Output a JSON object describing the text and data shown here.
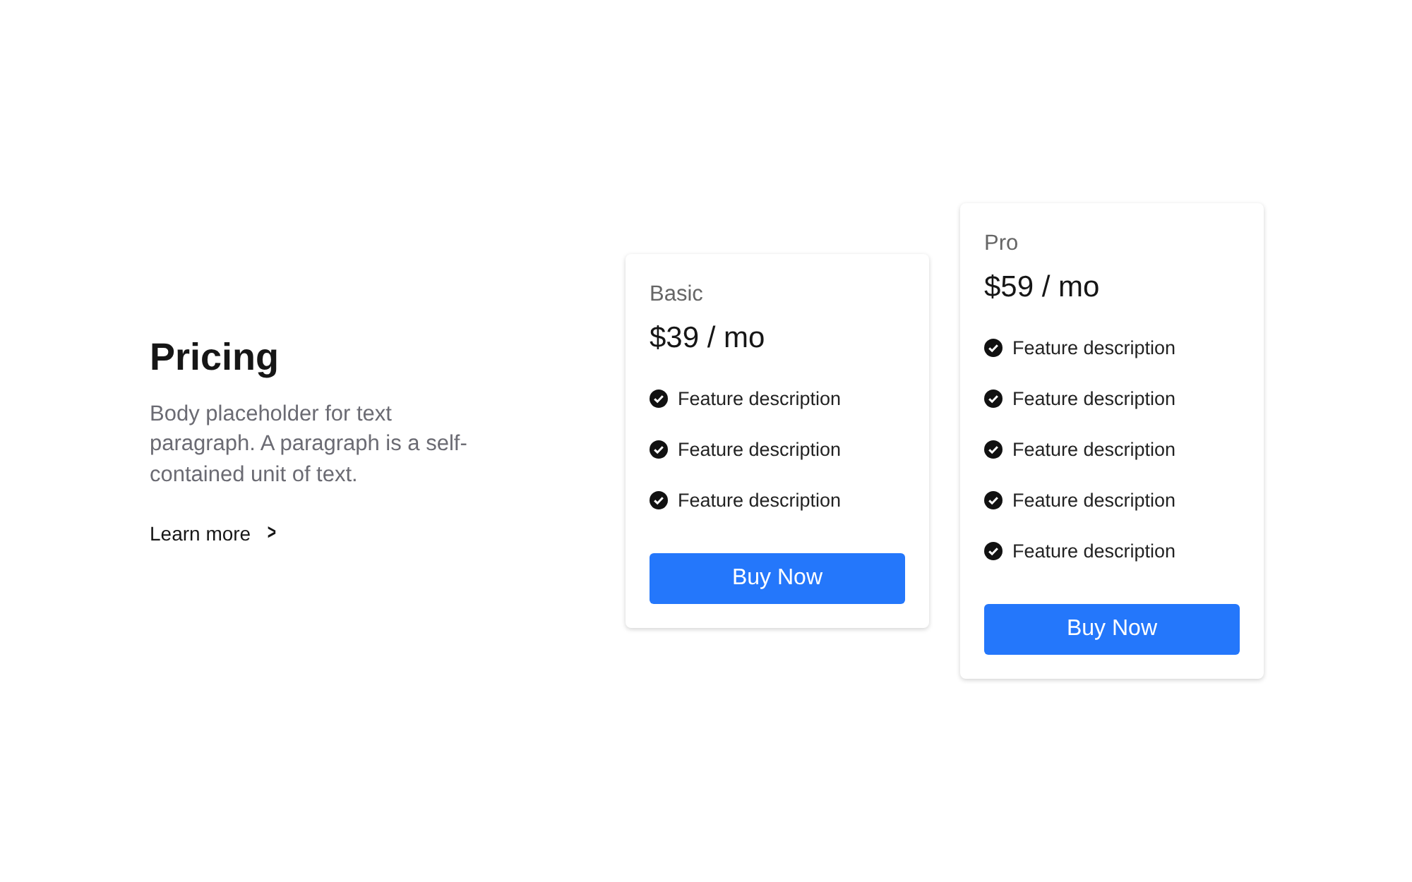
{
  "intro": {
    "title": "Pricing",
    "body": "Body placeholder for text paragraph. A paragraph is a self-contained unit of text.",
    "link": "Learn more",
    "link_icon": ">"
  },
  "plans": [
    {
      "name": "Basic",
      "price": "$39 / mo",
      "features": [
        "Feature description",
        "Feature description",
        "Feature description"
      ],
      "button": "Buy Now"
    },
    {
      "name": "Pro",
      "price": "$59 / mo",
      "features": [
        "Feature description",
        "Feature description",
        "Feature description",
        "Feature description",
        "Feature description"
      ],
      "button": "Buy Now"
    }
  ]
}
